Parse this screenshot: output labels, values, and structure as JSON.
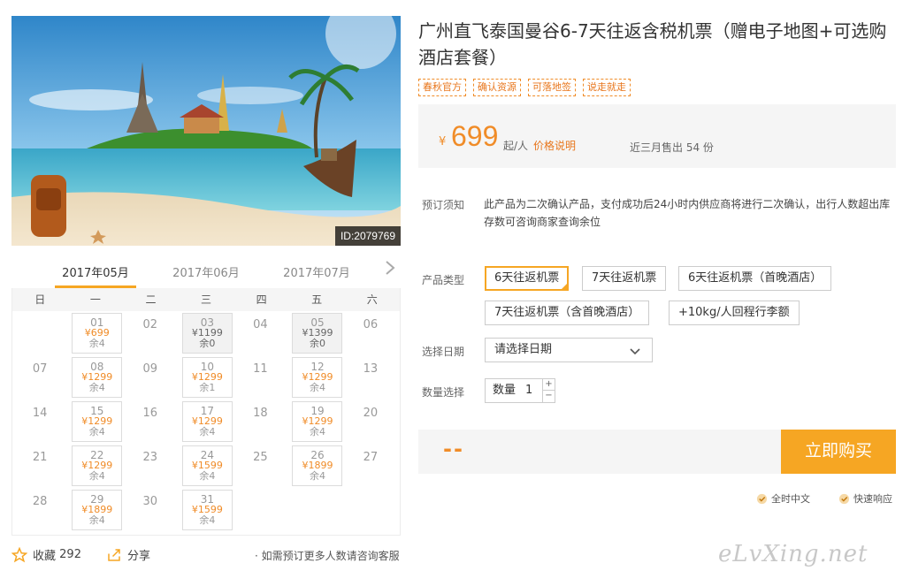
{
  "hero": {
    "id_label": "ID:2079769"
  },
  "months": [
    "2017年05月",
    "2017年06月",
    "2017年07月"
  ],
  "weekdays": [
    "日",
    "一",
    "二",
    "三",
    "四",
    "五",
    "六"
  ],
  "calendar": [
    [
      {
        "d": ""
      },
      {
        "d": "01",
        "p": "¥699",
        "r": "余4"
      },
      {
        "d": "02"
      },
      {
        "d": "03",
        "p": "¥1199",
        "r": "余0",
        "g": true
      },
      {
        "d": "04"
      },
      {
        "d": "05",
        "p": "¥1399",
        "r": "余0",
        "g": true
      },
      {
        "d": "06"
      }
    ],
    [
      {
        "d": "07"
      },
      {
        "d": "08",
        "p": "¥1299",
        "r": "余4"
      },
      {
        "d": "09"
      },
      {
        "d": "10",
        "p": "¥1299",
        "r": "余1"
      },
      {
        "d": "11"
      },
      {
        "d": "12",
        "p": "¥1299",
        "r": "余4"
      },
      {
        "d": "13"
      }
    ],
    [
      {
        "d": "14"
      },
      {
        "d": "15",
        "p": "¥1299",
        "r": "余4"
      },
      {
        "d": "16"
      },
      {
        "d": "17",
        "p": "¥1299",
        "r": "余4"
      },
      {
        "d": "18"
      },
      {
        "d": "19",
        "p": "¥1299",
        "r": "余4"
      },
      {
        "d": "20"
      }
    ],
    [
      {
        "d": "21"
      },
      {
        "d": "22",
        "p": "¥1299",
        "r": "余4"
      },
      {
        "d": "23"
      },
      {
        "d": "24",
        "p": "¥1599",
        "r": "余4"
      },
      {
        "d": "25"
      },
      {
        "d": "26",
        "p": "¥1899",
        "r": "余4"
      },
      {
        "d": "27"
      }
    ],
    [
      {
        "d": "28"
      },
      {
        "d": "29",
        "p": "¥1899",
        "r": "余4"
      },
      {
        "d": "30"
      },
      {
        "d": "31",
        "p": "¥1599",
        "r": "余4"
      },
      {
        "d": ""
      },
      {
        "d": ""
      },
      {
        "d": ""
      }
    ]
  ],
  "actions": {
    "fav_label": "收藏",
    "fav_count": "292",
    "share_label": "分享",
    "contact_notice": "· 如需预订更多人数请咨询客服"
  },
  "product": {
    "title": "广州直飞泰国曼谷6-7天往返含税机票（赠电子地图+可选购酒店套餐）",
    "tags": [
      "春秋官方",
      "确认资源",
      "可落地签",
      "说走就走"
    ],
    "price_yen": "¥",
    "price": "699",
    "price_unit": "起/人",
    "price_link": "价格说明",
    "sold": "近三月售出 54 份"
  },
  "booking": {
    "label": "预订须知",
    "text": "此产品为二次确认产品，支付成功后24小时内供应商将进行二次确认，出行人数超出库存数可咨询商家查询余位"
  },
  "product_type": {
    "label": "产品类型",
    "options": [
      "6天往返机票",
      "7天往返机票",
      "6天往返机票（首晚酒店）",
      "7天往返机票（含首晚酒店）",
      "+10kg/人回程行李额"
    ]
  },
  "date_select": {
    "label": "选择日期",
    "value": "请选择日期"
  },
  "quantity": {
    "label": "数量选择",
    "prefix": "数量",
    "value": "1",
    "plus": "+",
    "minus": "−"
  },
  "purchase": {
    "total": "--",
    "buy_label": "立即购买"
  },
  "services": [
    "全时中文",
    "快速响应"
  ],
  "watermark": "eLvXing.net",
  "colors": {
    "accent": "#f6a623",
    "price": "#f08c28"
  }
}
